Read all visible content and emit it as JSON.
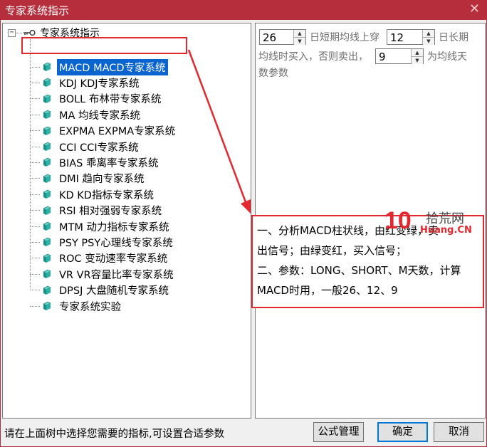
{
  "window": {
    "title": "专家系统指示",
    "close_glyph": "✕"
  },
  "tree": {
    "root_label": "专家系统指示",
    "root_expander": "−",
    "items": [
      {
        "label": "MACD MACD专家系统",
        "selected": true
      },
      {
        "label": "KDJ KDJ专家系统"
      },
      {
        "label": "BOLL 布林带专家系统"
      },
      {
        "label": "MA 均线专家系统"
      },
      {
        "label": "EXPMA EXPMA专家系统"
      },
      {
        "label": "CCI CCI专家系统"
      },
      {
        "label": "BIAS 乖离率专家系统"
      },
      {
        "label": "DMI 趋向专家系统"
      },
      {
        "label": "KD KD指标专家系统"
      },
      {
        "label": "RSI 相对强弱专家系统"
      },
      {
        "label": "MTM 动力指标专家系统"
      },
      {
        "label": "PSY PSY心理线专家系统"
      },
      {
        "label": "ROC 变动速率专家系统"
      },
      {
        "label": "VR VR容量比率专家系统"
      },
      {
        "label": "DPSJ 大盘随机专家系统"
      },
      {
        "label": "专家系统实验"
      }
    ]
  },
  "params": {
    "short_value": "26",
    "short_text": "日短期均线上穿",
    "long_value": "12",
    "long_text_1": "日长期",
    "line2_text": "均线时买入，否则卖出，",
    "m_value": "9",
    "line2_suffix": "为均线天",
    "line3_text": "数参数"
  },
  "description": {
    "line1": "一、分析MACD柱状线，由红变绿，卖",
    "line2": "出信号；由绿变红，买入信号；",
    "line3": "二、参数：LONG、SHORT、M天数，计算",
    "line4": "MACD时用，一般26、12、9"
  },
  "watermark": {
    "number": "10",
    "name": "拾荒网",
    "url": "Huang.CN"
  },
  "status_text": "请在上面树中选择您需要的指标,可设置合适参数",
  "buttons": {
    "formula": "公式管理",
    "ok": "确定",
    "cancel": "取消"
  },
  "colors": {
    "titlebar": "#b62e3c",
    "selection": "#0a64d0",
    "annotation_red": "#e2272f"
  }
}
